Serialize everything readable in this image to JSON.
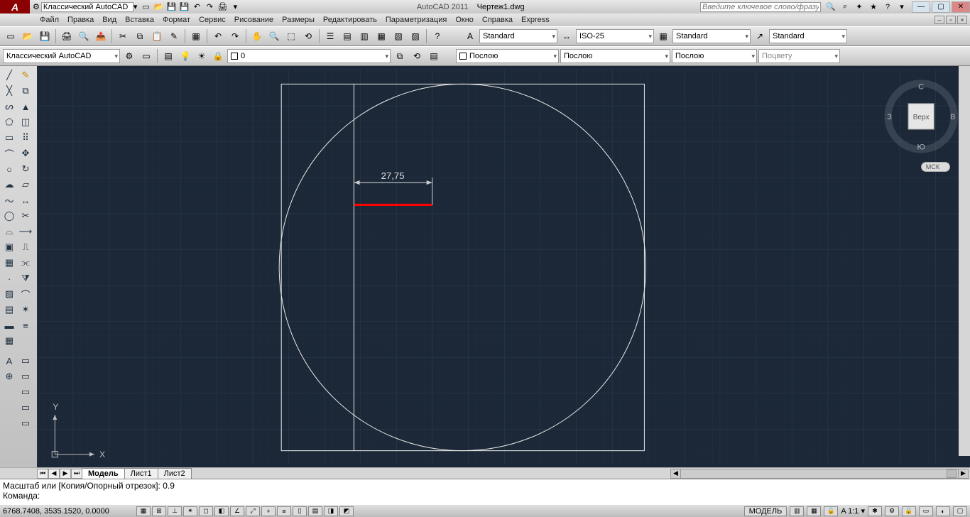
{
  "titlebar": {
    "workspace": "Классический AutoCAD",
    "app": "AutoCAD 2011",
    "file": "Чертеж1.dwg",
    "search_placeholder": "Введите ключевое слово/фразу"
  },
  "menu": {
    "items": [
      "Файл",
      "Правка",
      "Вид",
      "Вставка",
      "Формат",
      "Сервис",
      "Рисование",
      "Размеры",
      "Редактировать",
      "Параметризация",
      "Окно",
      "Справка",
      "Express"
    ]
  },
  "toolbar1": {
    "textstyle": "Standard",
    "dimstyle": "ISO-25",
    "tablestyle": "Standard",
    "mleaderstyle": "Standard"
  },
  "toolbar2": {
    "workspace": "Классический AutoCAD",
    "layer": "0",
    "layername": "0",
    "color": "Послою",
    "linetype": "Послою",
    "lineweight": "Послою",
    "plotstyle": "Поцвету"
  },
  "viewcube": {
    "top": "Верх",
    "n": "С",
    "s": "Ю",
    "e": "В",
    "w": "З",
    "ucs": "МСК"
  },
  "chart_data": {
    "type": "cad-drawing",
    "dimension_value": "27,75",
    "entities": [
      {
        "type": "rectangle",
        "visible": true
      },
      {
        "type": "circle",
        "visible": true
      },
      {
        "type": "vertical-line",
        "visible": true
      },
      {
        "type": "red-segment",
        "selected": true
      },
      {
        "type": "linear-dimension",
        "text": "27,75"
      }
    ]
  },
  "axes": {
    "x": "X",
    "y": "Y"
  },
  "tabs": {
    "model": "Модель",
    "sheets": [
      "Лист1",
      "Лист2"
    ]
  },
  "command": {
    "line1": "Масштаб или [Копия/Опорный отрезок]: 0.9",
    "line2": "Команда:"
  },
  "status": {
    "coords": "6768.7408, 3535.1520, 0.0000",
    "model": "МОДЕЛЬ",
    "scale": "1:1",
    "annoscale_icon": "A"
  }
}
